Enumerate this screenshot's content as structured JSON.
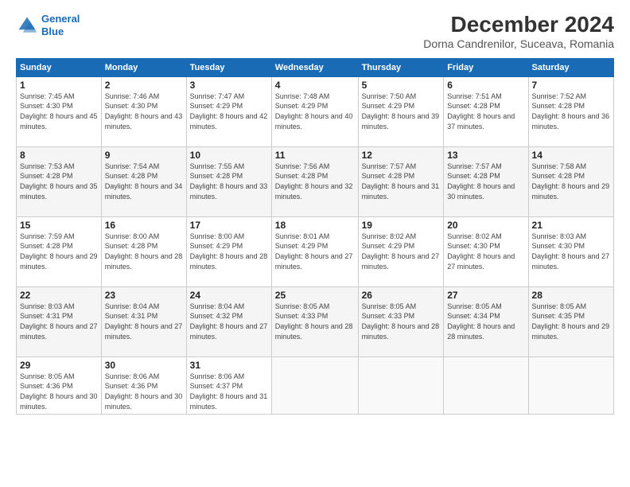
{
  "header": {
    "logo_line1": "General",
    "logo_line2": "Blue",
    "month_title": "December 2024",
    "location": "Dorna Candrenilor, Suceava, Romania"
  },
  "weekdays": [
    "Sunday",
    "Monday",
    "Tuesday",
    "Wednesday",
    "Thursday",
    "Friday",
    "Saturday"
  ],
  "weeks": [
    [
      {
        "day": "1",
        "sunrise": "7:45 AM",
        "sunset": "4:30 PM",
        "daylight": "8 hours and 45 minutes."
      },
      {
        "day": "2",
        "sunrise": "7:46 AM",
        "sunset": "4:30 PM",
        "daylight": "8 hours and 43 minutes."
      },
      {
        "day": "3",
        "sunrise": "7:47 AM",
        "sunset": "4:29 PM",
        "daylight": "8 hours and 42 minutes."
      },
      {
        "day": "4",
        "sunrise": "7:48 AM",
        "sunset": "4:29 PM",
        "daylight": "8 hours and 40 minutes."
      },
      {
        "day": "5",
        "sunrise": "7:50 AM",
        "sunset": "4:29 PM",
        "daylight": "8 hours and 39 minutes."
      },
      {
        "day": "6",
        "sunrise": "7:51 AM",
        "sunset": "4:28 PM",
        "daylight": "8 hours and 37 minutes."
      },
      {
        "day": "7",
        "sunrise": "7:52 AM",
        "sunset": "4:28 PM",
        "daylight": "8 hours and 36 minutes."
      }
    ],
    [
      {
        "day": "8",
        "sunrise": "7:53 AM",
        "sunset": "4:28 PM",
        "daylight": "8 hours and 35 minutes."
      },
      {
        "day": "9",
        "sunrise": "7:54 AM",
        "sunset": "4:28 PM",
        "daylight": "8 hours and 34 minutes."
      },
      {
        "day": "10",
        "sunrise": "7:55 AM",
        "sunset": "4:28 PM",
        "daylight": "8 hours and 33 minutes."
      },
      {
        "day": "11",
        "sunrise": "7:56 AM",
        "sunset": "4:28 PM",
        "daylight": "8 hours and 32 minutes."
      },
      {
        "day": "12",
        "sunrise": "7:57 AM",
        "sunset": "4:28 PM",
        "daylight": "8 hours and 31 minutes."
      },
      {
        "day": "13",
        "sunrise": "7:57 AM",
        "sunset": "4:28 PM",
        "daylight": "8 hours and 30 minutes."
      },
      {
        "day": "14",
        "sunrise": "7:58 AM",
        "sunset": "4:28 PM",
        "daylight": "8 hours and 29 minutes."
      }
    ],
    [
      {
        "day": "15",
        "sunrise": "7:59 AM",
        "sunset": "4:28 PM",
        "daylight": "8 hours and 29 minutes."
      },
      {
        "day": "16",
        "sunrise": "8:00 AM",
        "sunset": "4:28 PM",
        "daylight": "8 hours and 28 minutes."
      },
      {
        "day": "17",
        "sunrise": "8:00 AM",
        "sunset": "4:29 PM",
        "daylight": "8 hours and 28 minutes."
      },
      {
        "day": "18",
        "sunrise": "8:01 AM",
        "sunset": "4:29 PM",
        "daylight": "8 hours and 27 minutes."
      },
      {
        "day": "19",
        "sunrise": "8:02 AM",
        "sunset": "4:29 PM",
        "daylight": "8 hours and 27 minutes."
      },
      {
        "day": "20",
        "sunrise": "8:02 AM",
        "sunset": "4:30 PM",
        "daylight": "8 hours and 27 minutes."
      },
      {
        "day": "21",
        "sunrise": "8:03 AM",
        "sunset": "4:30 PM",
        "daylight": "8 hours and 27 minutes."
      }
    ],
    [
      {
        "day": "22",
        "sunrise": "8:03 AM",
        "sunset": "4:31 PM",
        "daylight": "8 hours and 27 minutes."
      },
      {
        "day": "23",
        "sunrise": "8:04 AM",
        "sunset": "4:31 PM",
        "daylight": "8 hours and 27 minutes."
      },
      {
        "day": "24",
        "sunrise": "8:04 AM",
        "sunset": "4:32 PM",
        "daylight": "8 hours and 27 minutes."
      },
      {
        "day": "25",
        "sunrise": "8:05 AM",
        "sunset": "4:33 PM",
        "daylight": "8 hours and 28 minutes."
      },
      {
        "day": "26",
        "sunrise": "8:05 AM",
        "sunset": "4:33 PM",
        "daylight": "8 hours and 28 minutes."
      },
      {
        "day": "27",
        "sunrise": "8:05 AM",
        "sunset": "4:34 PM",
        "daylight": "8 hours and 28 minutes."
      },
      {
        "day": "28",
        "sunrise": "8:05 AM",
        "sunset": "4:35 PM",
        "daylight": "8 hours and 29 minutes."
      }
    ],
    [
      {
        "day": "29",
        "sunrise": "8:05 AM",
        "sunset": "4:36 PM",
        "daylight": "8 hours and 30 minutes."
      },
      {
        "day": "30",
        "sunrise": "8:06 AM",
        "sunset": "4:36 PM",
        "daylight": "8 hours and 30 minutes."
      },
      {
        "day": "31",
        "sunrise": "8:06 AM",
        "sunset": "4:37 PM",
        "daylight": "8 hours and 31 minutes."
      },
      null,
      null,
      null,
      null
    ]
  ]
}
